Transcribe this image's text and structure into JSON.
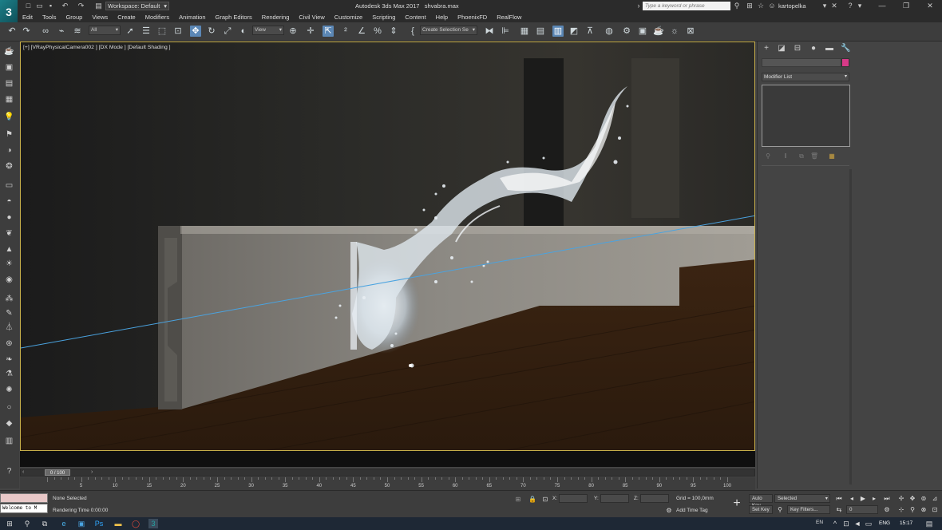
{
  "app": {
    "logo": "3",
    "title": "Autodesk 3ds Max 2017",
    "file": "shvabra.max",
    "workspace": "Workspace: Default",
    "search_placeholder": "Type a keyword or phrase",
    "user": "kartopelka"
  },
  "menu": [
    "Edit",
    "Tools",
    "Group",
    "Views",
    "Create",
    "Modifiers",
    "Animation",
    "Graph Editors",
    "Rendering",
    "Civil View",
    "Customize",
    "Scripting",
    "Content",
    "Help",
    "PhoenixFD",
    "RealFlow"
  ],
  "toolbar": {
    "filter": "All",
    "refcoord": "View",
    "selection_set": "Create Selection Se"
  },
  "viewport": {
    "label": "[+] [VRayPhysicalCamera002 ] [DX Mode ] [Default Shading ]"
  },
  "timeline": {
    "frame": "0 / 100",
    "ticks": [
      5,
      10,
      15,
      20,
      25,
      30,
      35,
      40,
      45,
      50,
      55,
      60,
      65,
      70,
      75,
      80,
      85,
      90,
      95,
      100
    ]
  },
  "command_panel": {
    "modifier_list": "Modifier List",
    "swatch_color": "#d83a88"
  },
  "status": {
    "maxscript": "Welcome to M",
    "selection": "None Selected",
    "render_time": "Rendering Time  0:00:00",
    "x_label": "X:",
    "y_label": "Y:",
    "z_label": "Z:",
    "grid": "Grid = 100,0mm",
    "add_time_tag": "Add Time Tag",
    "auto_key": "Auto Key",
    "set_key": "Set Key",
    "selected": "Selected",
    "key_filters": "Key Filters...",
    "frame_value": "0"
  },
  "taskbar": {
    "input_lang": "EN",
    "lang": "ENG",
    "time": "15:17"
  }
}
